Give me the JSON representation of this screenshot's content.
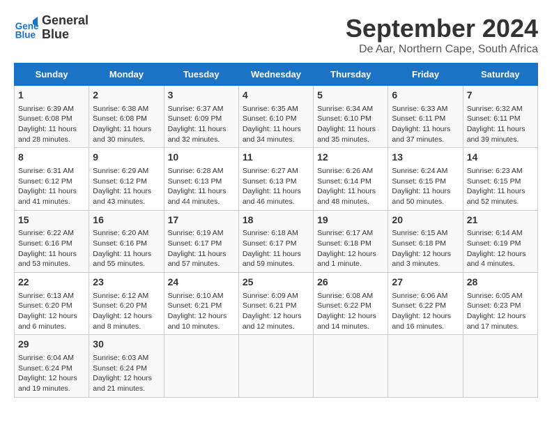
{
  "logo": {
    "line1": "General",
    "line2": "Blue"
  },
  "title": "September 2024",
  "location": "De Aar, Northern Cape, South Africa",
  "days_of_week": [
    "Sunday",
    "Monday",
    "Tuesday",
    "Wednesday",
    "Thursday",
    "Friday",
    "Saturday"
  ],
  "weeks": [
    [
      {
        "day": "1",
        "info": "Sunrise: 6:39 AM\nSunset: 6:08 PM\nDaylight: 11 hours\nand 28 minutes."
      },
      {
        "day": "2",
        "info": "Sunrise: 6:38 AM\nSunset: 6:08 PM\nDaylight: 11 hours\nand 30 minutes."
      },
      {
        "day": "3",
        "info": "Sunrise: 6:37 AM\nSunset: 6:09 PM\nDaylight: 11 hours\nand 32 minutes."
      },
      {
        "day": "4",
        "info": "Sunrise: 6:35 AM\nSunset: 6:10 PM\nDaylight: 11 hours\nand 34 minutes."
      },
      {
        "day": "5",
        "info": "Sunrise: 6:34 AM\nSunset: 6:10 PM\nDaylight: 11 hours\nand 35 minutes."
      },
      {
        "day": "6",
        "info": "Sunrise: 6:33 AM\nSunset: 6:11 PM\nDaylight: 11 hours\nand 37 minutes."
      },
      {
        "day": "7",
        "info": "Sunrise: 6:32 AM\nSunset: 6:11 PM\nDaylight: 11 hours\nand 39 minutes."
      }
    ],
    [
      {
        "day": "8",
        "info": "Sunrise: 6:31 AM\nSunset: 6:12 PM\nDaylight: 11 hours\nand 41 minutes."
      },
      {
        "day": "9",
        "info": "Sunrise: 6:29 AM\nSunset: 6:12 PM\nDaylight: 11 hours\nand 43 minutes."
      },
      {
        "day": "10",
        "info": "Sunrise: 6:28 AM\nSunset: 6:13 PM\nDaylight: 11 hours\nand 44 minutes."
      },
      {
        "day": "11",
        "info": "Sunrise: 6:27 AM\nSunset: 6:13 PM\nDaylight: 11 hours\nand 46 minutes."
      },
      {
        "day": "12",
        "info": "Sunrise: 6:26 AM\nSunset: 6:14 PM\nDaylight: 11 hours\nand 48 minutes."
      },
      {
        "day": "13",
        "info": "Sunrise: 6:24 AM\nSunset: 6:15 PM\nDaylight: 11 hours\nand 50 minutes."
      },
      {
        "day": "14",
        "info": "Sunrise: 6:23 AM\nSunset: 6:15 PM\nDaylight: 11 hours\nand 52 minutes."
      }
    ],
    [
      {
        "day": "15",
        "info": "Sunrise: 6:22 AM\nSunset: 6:16 PM\nDaylight: 11 hours\nand 53 minutes."
      },
      {
        "day": "16",
        "info": "Sunrise: 6:20 AM\nSunset: 6:16 PM\nDaylight: 11 hours\nand 55 minutes."
      },
      {
        "day": "17",
        "info": "Sunrise: 6:19 AM\nSunset: 6:17 PM\nDaylight: 11 hours\nand 57 minutes."
      },
      {
        "day": "18",
        "info": "Sunrise: 6:18 AM\nSunset: 6:17 PM\nDaylight: 11 hours\nand 59 minutes."
      },
      {
        "day": "19",
        "info": "Sunrise: 6:17 AM\nSunset: 6:18 PM\nDaylight: 12 hours\nand 1 minute."
      },
      {
        "day": "20",
        "info": "Sunrise: 6:15 AM\nSunset: 6:18 PM\nDaylight: 12 hours\nand 3 minutes."
      },
      {
        "day": "21",
        "info": "Sunrise: 6:14 AM\nSunset: 6:19 PM\nDaylight: 12 hours\nand 4 minutes."
      }
    ],
    [
      {
        "day": "22",
        "info": "Sunrise: 6:13 AM\nSunset: 6:20 PM\nDaylight: 12 hours\nand 6 minutes."
      },
      {
        "day": "23",
        "info": "Sunrise: 6:12 AM\nSunset: 6:20 PM\nDaylight: 12 hours\nand 8 minutes."
      },
      {
        "day": "24",
        "info": "Sunrise: 6:10 AM\nSunset: 6:21 PM\nDaylight: 12 hours\nand 10 minutes."
      },
      {
        "day": "25",
        "info": "Sunrise: 6:09 AM\nSunset: 6:21 PM\nDaylight: 12 hours\nand 12 minutes."
      },
      {
        "day": "26",
        "info": "Sunrise: 6:08 AM\nSunset: 6:22 PM\nDaylight: 12 hours\nand 14 minutes."
      },
      {
        "day": "27",
        "info": "Sunrise: 6:06 AM\nSunset: 6:22 PM\nDaylight: 12 hours\nand 16 minutes."
      },
      {
        "day": "28",
        "info": "Sunrise: 6:05 AM\nSunset: 6:23 PM\nDaylight: 12 hours\nand 17 minutes."
      }
    ],
    [
      {
        "day": "29",
        "info": "Sunrise: 6:04 AM\nSunset: 6:24 PM\nDaylight: 12 hours\nand 19 minutes."
      },
      {
        "day": "30",
        "info": "Sunrise: 6:03 AM\nSunset: 6:24 PM\nDaylight: 12 hours\nand 21 minutes."
      },
      {
        "day": "",
        "info": ""
      },
      {
        "day": "",
        "info": ""
      },
      {
        "day": "",
        "info": ""
      },
      {
        "day": "",
        "info": ""
      },
      {
        "day": "",
        "info": ""
      }
    ]
  ]
}
